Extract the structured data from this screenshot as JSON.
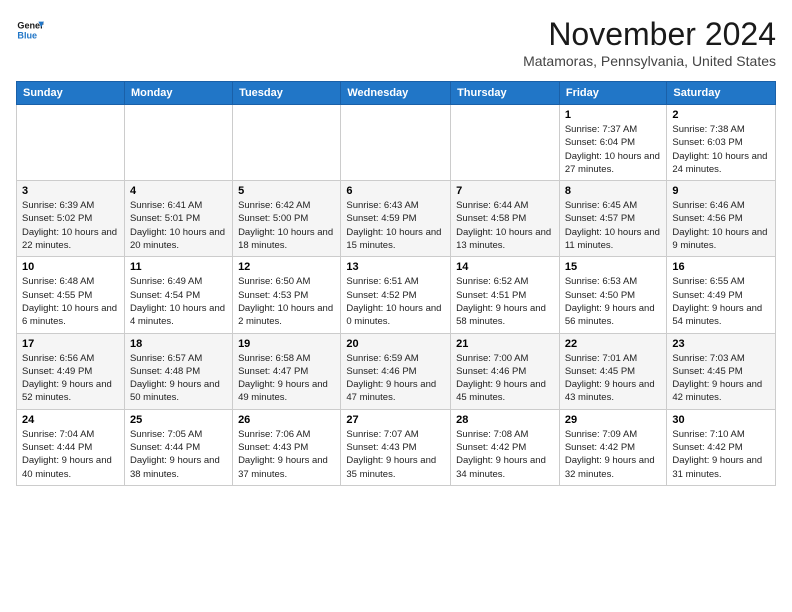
{
  "logo": {
    "line1": "General",
    "line2": "Blue"
  },
  "title": "November 2024",
  "location": "Matamoras, Pennsylvania, United States",
  "days_of_week": [
    "Sunday",
    "Monday",
    "Tuesday",
    "Wednesday",
    "Thursday",
    "Friday",
    "Saturday"
  ],
  "weeks": [
    [
      {
        "day": null
      },
      {
        "day": null
      },
      {
        "day": null
      },
      {
        "day": null
      },
      {
        "day": null
      },
      {
        "day": "1",
        "sunrise": "7:37 AM",
        "sunset": "6:04 PM",
        "daylight": "10 hours and 27 minutes."
      },
      {
        "day": "2",
        "sunrise": "7:38 AM",
        "sunset": "6:03 PM",
        "daylight": "10 hours and 24 minutes."
      }
    ],
    [
      {
        "day": "3",
        "sunrise": "6:39 AM",
        "sunset": "5:02 PM",
        "daylight": "10 hours and 22 minutes."
      },
      {
        "day": "4",
        "sunrise": "6:41 AM",
        "sunset": "5:01 PM",
        "daylight": "10 hours and 20 minutes."
      },
      {
        "day": "5",
        "sunrise": "6:42 AM",
        "sunset": "5:00 PM",
        "daylight": "10 hours and 18 minutes."
      },
      {
        "day": "6",
        "sunrise": "6:43 AM",
        "sunset": "4:59 PM",
        "daylight": "10 hours and 15 minutes."
      },
      {
        "day": "7",
        "sunrise": "6:44 AM",
        "sunset": "4:58 PM",
        "daylight": "10 hours and 13 minutes."
      },
      {
        "day": "8",
        "sunrise": "6:45 AM",
        "sunset": "4:57 PM",
        "daylight": "10 hours and 11 minutes."
      },
      {
        "day": "9",
        "sunrise": "6:46 AM",
        "sunset": "4:56 PM",
        "daylight": "10 hours and 9 minutes."
      }
    ],
    [
      {
        "day": "10",
        "sunrise": "6:48 AM",
        "sunset": "4:55 PM",
        "daylight": "10 hours and 6 minutes."
      },
      {
        "day": "11",
        "sunrise": "6:49 AM",
        "sunset": "4:54 PM",
        "daylight": "10 hours and 4 minutes."
      },
      {
        "day": "12",
        "sunrise": "6:50 AM",
        "sunset": "4:53 PM",
        "daylight": "10 hours and 2 minutes."
      },
      {
        "day": "13",
        "sunrise": "6:51 AM",
        "sunset": "4:52 PM",
        "daylight": "10 hours and 0 minutes."
      },
      {
        "day": "14",
        "sunrise": "6:52 AM",
        "sunset": "4:51 PM",
        "daylight": "9 hours and 58 minutes."
      },
      {
        "day": "15",
        "sunrise": "6:53 AM",
        "sunset": "4:50 PM",
        "daylight": "9 hours and 56 minutes."
      },
      {
        "day": "16",
        "sunrise": "6:55 AM",
        "sunset": "4:49 PM",
        "daylight": "9 hours and 54 minutes."
      }
    ],
    [
      {
        "day": "17",
        "sunrise": "6:56 AM",
        "sunset": "4:49 PM",
        "daylight": "9 hours and 52 minutes."
      },
      {
        "day": "18",
        "sunrise": "6:57 AM",
        "sunset": "4:48 PM",
        "daylight": "9 hours and 50 minutes."
      },
      {
        "day": "19",
        "sunrise": "6:58 AM",
        "sunset": "4:47 PM",
        "daylight": "9 hours and 49 minutes."
      },
      {
        "day": "20",
        "sunrise": "6:59 AM",
        "sunset": "4:46 PM",
        "daylight": "9 hours and 47 minutes."
      },
      {
        "day": "21",
        "sunrise": "7:00 AM",
        "sunset": "4:46 PM",
        "daylight": "9 hours and 45 minutes."
      },
      {
        "day": "22",
        "sunrise": "7:01 AM",
        "sunset": "4:45 PM",
        "daylight": "9 hours and 43 minutes."
      },
      {
        "day": "23",
        "sunrise": "7:03 AM",
        "sunset": "4:45 PM",
        "daylight": "9 hours and 42 minutes."
      }
    ],
    [
      {
        "day": "24",
        "sunrise": "7:04 AM",
        "sunset": "4:44 PM",
        "daylight": "9 hours and 40 minutes."
      },
      {
        "day": "25",
        "sunrise": "7:05 AM",
        "sunset": "4:44 PM",
        "daylight": "9 hours and 38 minutes."
      },
      {
        "day": "26",
        "sunrise": "7:06 AM",
        "sunset": "4:43 PM",
        "daylight": "9 hours and 37 minutes."
      },
      {
        "day": "27",
        "sunrise": "7:07 AM",
        "sunset": "4:43 PM",
        "daylight": "9 hours and 35 minutes."
      },
      {
        "day": "28",
        "sunrise": "7:08 AM",
        "sunset": "4:42 PM",
        "daylight": "9 hours and 34 minutes."
      },
      {
        "day": "29",
        "sunrise": "7:09 AM",
        "sunset": "4:42 PM",
        "daylight": "9 hours and 32 minutes."
      },
      {
        "day": "30",
        "sunrise": "7:10 AM",
        "sunset": "4:42 PM",
        "daylight": "9 hours and 31 minutes."
      }
    ]
  ]
}
